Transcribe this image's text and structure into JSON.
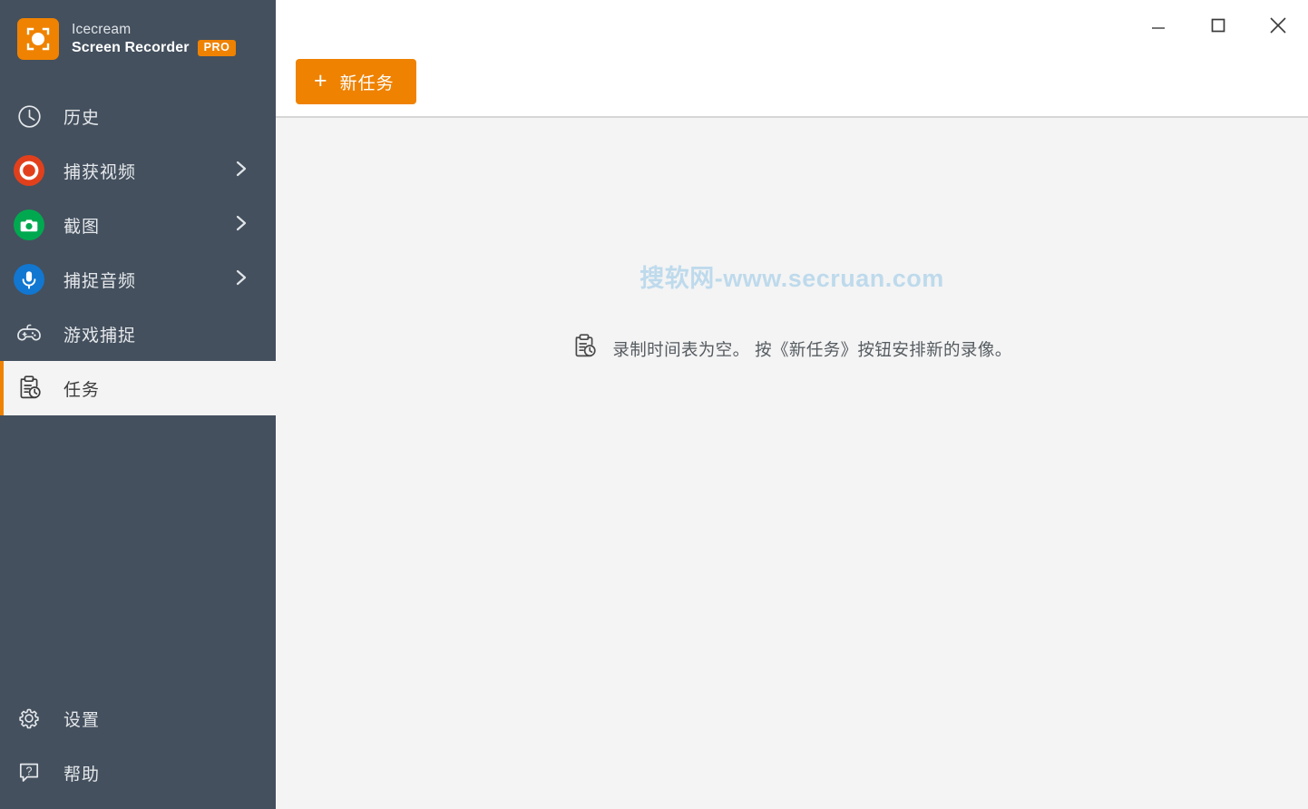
{
  "app": {
    "brand_line1": "Icecream",
    "brand_line2": "Screen Recorder",
    "pro_badge": "PRO",
    "logo_icon": "record-viewfinder-icon"
  },
  "window_controls": {
    "minimize": "minimize-icon",
    "maximize": "maximize-icon",
    "close": "close-icon"
  },
  "sidebar": {
    "items": [
      {
        "label": "历史",
        "icon": "clock-icon",
        "has_chevron": false,
        "selected": false
      },
      {
        "label": "捕获视频",
        "icon": "record-circle-icon",
        "has_chevron": true,
        "selected": false
      },
      {
        "label": "截图",
        "icon": "camera-circle-icon",
        "has_chevron": true,
        "selected": false
      },
      {
        "label": "捕捉音频",
        "icon": "microphone-circle-icon",
        "has_chevron": true,
        "selected": false
      },
      {
        "label": "游戏捕捉",
        "icon": "gamepad-icon",
        "has_chevron": false,
        "selected": false
      },
      {
        "label": "任务",
        "icon": "task-clipboard-clock-icon",
        "has_chevron": false,
        "selected": true
      }
    ],
    "bottom_items": [
      {
        "label": "设置",
        "icon": "gear-icon"
      },
      {
        "label": "帮助",
        "icon": "help-question-icon"
      }
    ]
  },
  "toolbar": {
    "new_task_label": "新任务",
    "new_task_plus": "+"
  },
  "main": {
    "watermark": "搜软网-www.secruan.com",
    "empty_state_icon": "task-clipboard-clock-icon",
    "empty_state_text": "录制时间表为空。 按《新任务》按钮安排新的录像。"
  },
  "colors": {
    "sidebar_bg": "#44505e",
    "accent_orange": "#ef8200",
    "content_bg": "#f4f4f4",
    "record_red": "#e2401c",
    "camera_green": "#00a94f",
    "mic_blue": "#1177d1",
    "watermark_blue": "#bcd9ec"
  }
}
